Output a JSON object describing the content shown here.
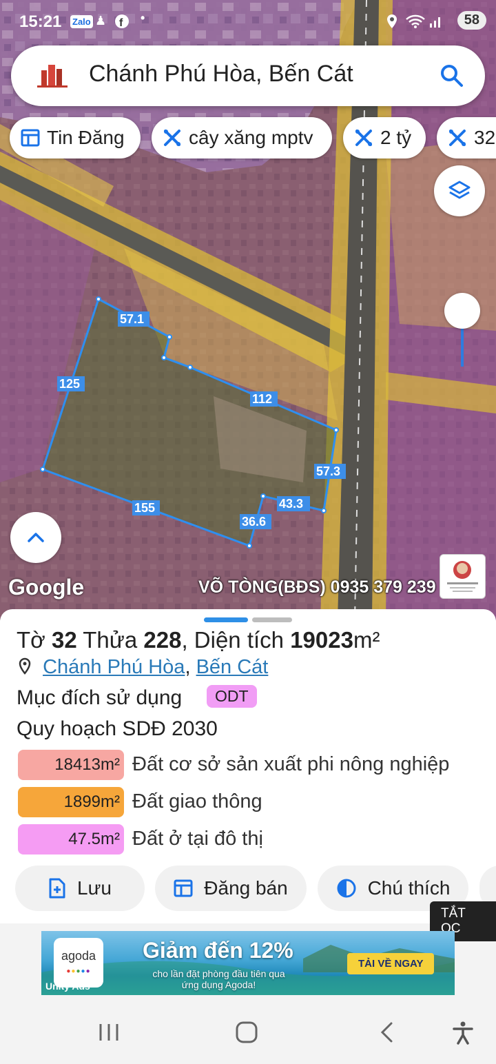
{
  "status_bar": {
    "time": "15:21",
    "battery": "58",
    "icons": [
      "zalo-icon",
      "contacts-icon",
      "facebook-icon",
      "dot-icon",
      "location-icon",
      "wifi-icon",
      "signal-icon"
    ]
  },
  "search": {
    "query": "Chánh Phú Hòa, Bến Cát",
    "icon": "search-icon"
  },
  "chips": [
    {
      "label": "Tin Đăng",
      "icon": "table-icon"
    },
    {
      "label": "cây xăng mptv",
      "icon": "tools-icon"
    },
    {
      "label": "2 tỷ",
      "icon": "tools-icon"
    },
    {
      "label": "32",
      "icon": "tools-icon"
    }
  ],
  "map": {
    "parcel_edges": [
      "57.1",
      "125",
      "112",
      "57.3",
      "43.3",
      "36.6",
      "155"
    ],
    "google_label": "Google",
    "watermark": "VÕ TÒNG(BĐS) 0935 379 239",
    "colors": {
      "parcel_outline": "#2e8ff0",
      "residential": "#b24fb8",
      "roads": "#e0c233",
      "edge_label_bg": "#3d8ee8"
    }
  },
  "sheet": {
    "title_pre": "Tờ ",
    "sheet_no": "32",
    "title_mid": " Thửa ",
    "parcel_no": "228",
    "title_area_label": ", Diện tích ",
    "area_value": "19023",
    "area_unit": "m²",
    "location_commune": "Chánh Phú Hòa",
    "location_sep": ", ",
    "location_district": "Bến Cát",
    "purpose_label": "Mục đích sử dụng",
    "purpose_tag": "ODT",
    "plan_label": "Quy hoạch SDĐ 2030",
    "plan_rows": [
      {
        "area": "18413m²",
        "desc": "Đất cơ sở sản xuất phi nông nghiệp",
        "color": "#f7a7a2"
      },
      {
        "area": "1899m²",
        "desc": "Đất giao thông",
        "color": "#f6a63a"
      },
      {
        "area": "47.5m²",
        "desc": "Đất ở tại đô thị",
        "color": "#f59cf3"
      }
    ],
    "actions": [
      {
        "label": "Lưu",
        "icon": "add-file-icon"
      },
      {
        "label": "Đăng bán",
        "icon": "table-icon"
      },
      {
        "label": "Chú thích",
        "icon": "contrast-icon"
      }
    ]
  },
  "ad": {
    "close_label": "TẮT QC",
    "brand": "agoda",
    "headline": "Giảm đến 12%",
    "subline": "cho lần đặt phòng đầu tiên qua ứng dụng Agoda!",
    "cta": "TẢI VỀ NGAY",
    "network": "Unity Ads"
  },
  "nav_bar": {
    "buttons": [
      "recent-apps-icon",
      "home-icon",
      "back-icon",
      "accessibility-icon"
    ]
  }
}
